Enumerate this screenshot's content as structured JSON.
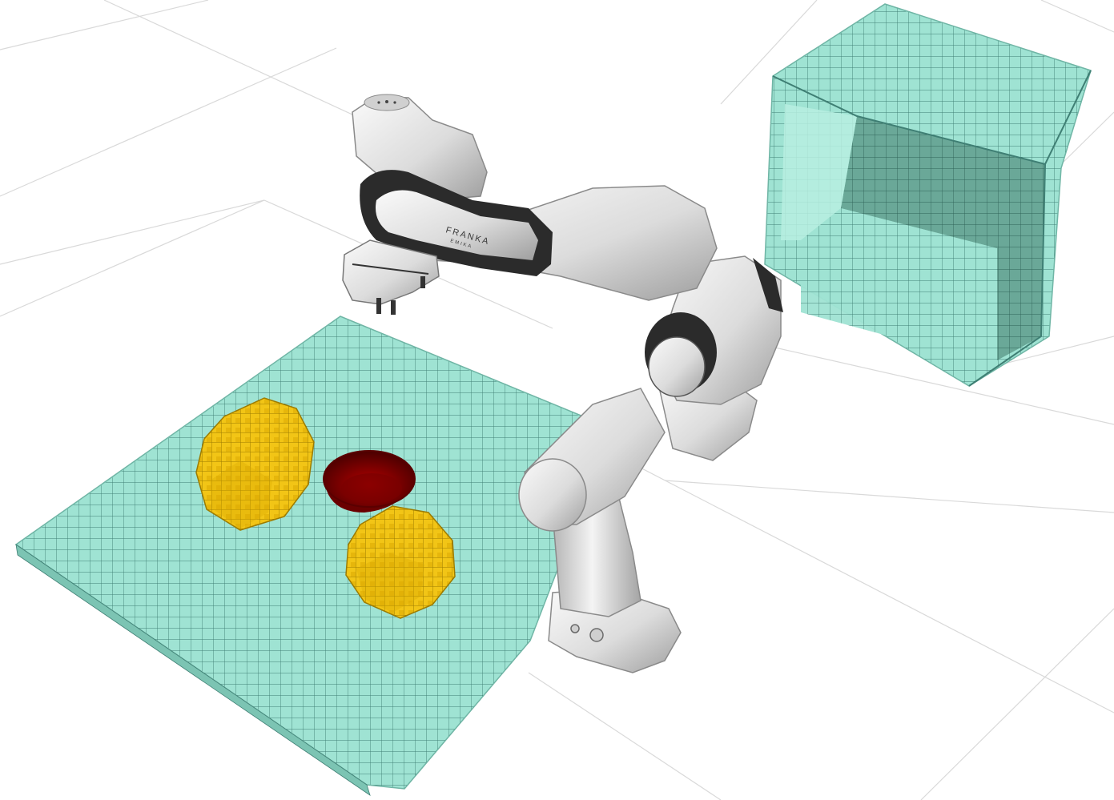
{
  "viewport": {
    "background_color": "#ffffff",
    "floor_grid_color": "#d9d9d9"
  },
  "scene": {
    "table": {
      "color": "#9fe3d3",
      "grid_color": "#3f7f74",
      "edge_color": "#6fb5a5"
    },
    "cabinet": {
      "color": "#9fe3d3",
      "interior_color": "#5e9f90",
      "grid_color": "#3f7f74"
    },
    "objects": [
      {
        "kind": "voxel-blob",
        "color": "#f2c516",
        "shadow_color": "#b38e00"
      },
      {
        "kind": "voxel-blob",
        "color": "#f2c516",
        "shadow_color": "#b38e00"
      },
      {
        "kind": "bowl",
        "color": "#8a0000",
        "rim_color": "#b00000"
      }
    ],
    "robot": {
      "link_color": "#e8e8e8",
      "shade_color": "#a9a9a9",
      "joint_band_color": "#2b2b2b",
      "brand_primary": "FRANKA",
      "brand_secondary": "EMIKA"
    }
  }
}
